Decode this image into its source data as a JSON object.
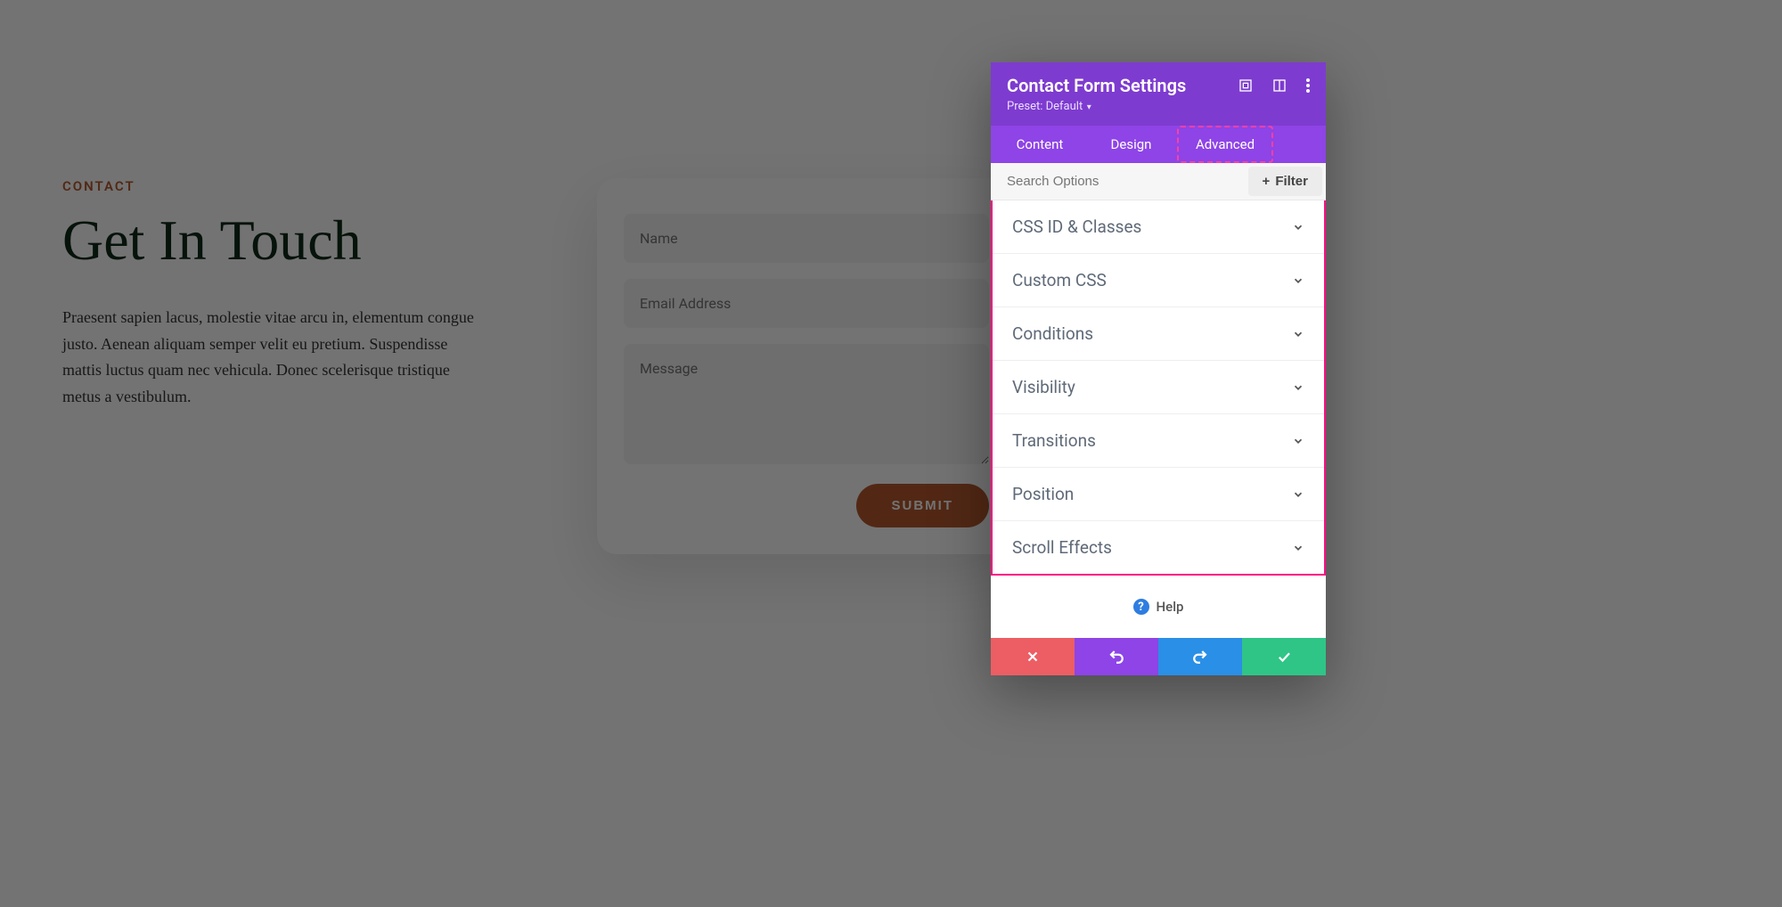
{
  "page": {
    "eyebrow": "CONTACT",
    "title": "Get In Touch",
    "description": "Praesent sapien lacus, molestie vitae arcu in, elementum congue justo. Aenean aliquam semper velit eu pretium. Suspendisse mattis luctus quam nec vehicula. Donec scelerisque tristique metus a vestibulum."
  },
  "form": {
    "name_placeholder": "Name",
    "email_placeholder": "Email Address",
    "message_placeholder": "Message",
    "submit_label": "SUBMIT"
  },
  "panel": {
    "title": "Contact Form Settings",
    "preset_label": "Preset: Default",
    "tabs": {
      "content": "Content",
      "design": "Design",
      "advanced": "Advanced",
      "active": "advanced"
    },
    "search_placeholder": "Search Options",
    "filter_label": "Filter",
    "options": [
      "CSS ID & Classes",
      "Custom CSS",
      "Conditions",
      "Visibility",
      "Transitions",
      "Position",
      "Scroll Effects"
    ],
    "help_label": "Help"
  }
}
